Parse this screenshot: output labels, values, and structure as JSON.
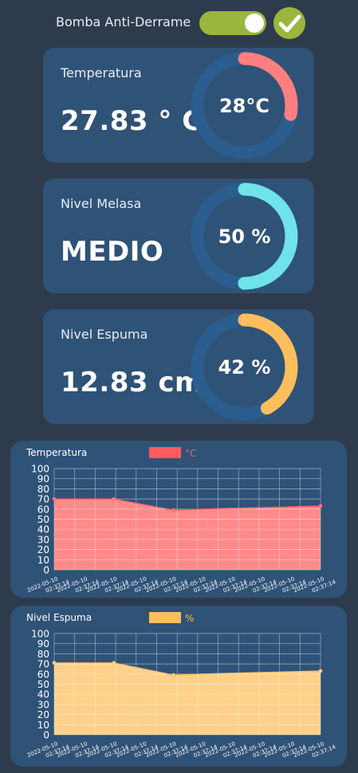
{
  "pump": {
    "label": "Bomba Anti-Derrame",
    "enabled": true
  },
  "colors": {
    "accent_green": "#9ab63d",
    "temp": "#ff7f80",
    "melasa": "#6fe3ea",
    "espuma": "#ffbe5c",
    "ring_track": "#2c5d8f"
  },
  "cards": [
    {
      "label": "Temperatura",
      "value": "27.83 ° C",
      "gauge_text": "28°C",
      "percent": 28,
      "color": "#ff7f80"
    },
    {
      "label": "Nivel Melasa",
      "value": "MEDIO",
      "gauge_text": "50 %",
      "percent": 50,
      "color": "#6fe3ea"
    },
    {
      "label": "Nivel Espuma",
      "value": "12.83 cm",
      "gauge_text": "42 %",
      "percent": 42,
      "color": "#ffbe5c"
    }
  ],
  "chart_data": [
    {
      "type": "area",
      "title": "Temperatura",
      "series": [
        {
          "name": "°C",
          "values": [
            70,
            70,
            59,
            60,
            61,
            62,
            63
          ]
        }
      ],
      "x": [
        "2022-05-10 02:37:14",
        "2022-05-10 02:37:14",
        "2022-05-10 02:37:14",
        "2022-05-10 02:37:14",
        "2022-05-10 02:37:14",
        "2022-05-10 02:37:14",
        "2022-05-10 02:37:14"
      ],
      "x_tick_labels": [
        "2022-05-10 02:37:14",
        "2022-05-10 02:37:14",
        "2022-05-10 02:37:14",
        "2022-05-10 02:37:14",
        "2022-05-10 02:37:14",
        "2022-05-10 02:37:14",
        "2022-05-10 02:37:14",
        "2022-05-10 02:37:14",
        "2022-05-10 02:37:14",
        "2022-05-10 02:37:14"
      ],
      "y_ticks": [
        0,
        10,
        20,
        30,
        40,
        50,
        60,
        70,
        80,
        90,
        100
      ],
      "ylim": [
        0,
        100
      ],
      "grid": true,
      "legend": "top",
      "fill": "#ff8a8a",
      "legend_color": "#ff5a5f"
    },
    {
      "type": "area",
      "title": "Nivel Espuma",
      "series": [
        {
          "name": "%",
          "values": [
            71,
            71,
            59,
            60,
            61,
            62,
            63
          ]
        }
      ],
      "x": [
        "2022-05-10 02:37:14",
        "2022-05-10 02:37:14",
        "2022-05-10 02:37:14",
        "2022-05-10 02:37:14",
        "2022-05-10 02:37:14",
        "2022-05-10 02:37:14",
        "2022-05-10 02:37:14"
      ],
      "x_tick_labels": [
        "2022-05-10 02:37:14",
        "2022-05-10 02:37:14",
        "2022-05-10 02:37:14",
        "2022-05-10 02:37:14",
        "2022-05-10 02:37:14",
        "2022-05-10 02:37:14",
        "2022-05-10 02:37:14",
        "2022-05-10 02:37:14",
        "2022-05-10 02:37:14",
        "2022-05-10 02:37:14"
      ],
      "y_ticks": [
        0,
        10,
        20,
        30,
        40,
        50,
        60,
        70,
        80,
        90,
        100
      ],
      "ylim": [
        0,
        100
      ],
      "grid": true,
      "legend": "top",
      "fill": "#ffd08a",
      "legend_color": "#ffbe5c"
    }
  ]
}
